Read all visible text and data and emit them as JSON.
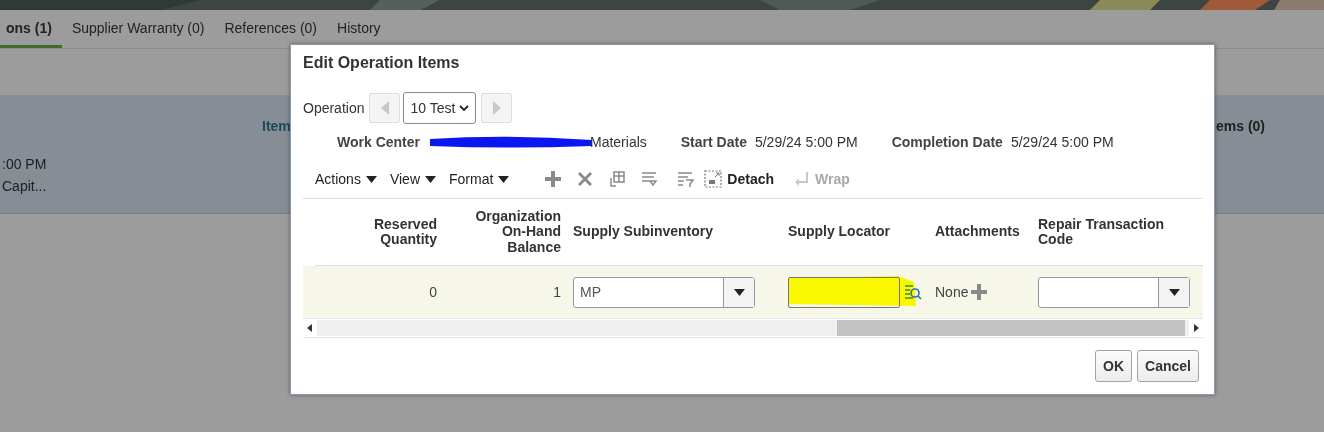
{
  "background": {
    "tabs": [
      {
        "label": "ons (1)",
        "selected": true
      },
      {
        "label": "Supplier Warranty (0)",
        "selected": false
      },
      {
        "label": "References (0)",
        "selected": false
      },
      {
        "label": "History",
        "selected": false
      }
    ],
    "panel": {
      "heading": "Item",
      "time": ":00 PM",
      "location": "Capit...",
      "right_heading": "ems (0)"
    }
  },
  "dialog": {
    "title": "Edit Operation Items",
    "operation": {
      "label": "Operation",
      "value": "10 Test",
      "prev_disabled": true,
      "next_disabled": true
    },
    "info": [
      {
        "label": "Work Center",
        "value": "Materials",
        "redacted": true
      },
      {
        "label": "Start Date",
        "value": "5/29/24 5:00 PM",
        "redacted": false
      },
      {
        "label": "Completion Date",
        "value": "5/29/24 5:00 PM",
        "redacted": false
      }
    ],
    "menus": [
      "Actions",
      "View",
      "Format"
    ],
    "tools": [
      {
        "kind": "add",
        "disabled": false
      },
      {
        "kind": "delete",
        "disabled": false
      },
      {
        "kind": "freeze",
        "disabled": false
      },
      {
        "kind": "wrap-rows",
        "disabled": false
      },
      {
        "kind": "query",
        "disabled": false
      }
    ],
    "detach": {
      "label": "Detach",
      "disabled": false
    },
    "wrap": {
      "label": "Wrap",
      "disabled": true
    },
    "table": {
      "columns": [
        "Reserved Quantity",
        "Organization On-Hand Balance",
        "Supply Subinventory",
        "Supply Locator",
        "Attachments",
        "Repair Transaction Code"
      ],
      "rows": [
        {
          "selected": true,
          "cells": [
            {
              "kind": "number",
              "text": "0"
            },
            {
              "kind": "number",
              "text": "1"
            },
            {
              "kind": "select",
              "value": "MP"
            },
            {
              "kind": "locator",
              "highlighted": true
            },
            {
              "kind": "attachments",
              "text": "None"
            },
            {
              "kind": "select"
            }
          ]
        }
      ]
    },
    "buttons": [
      "OK",
      "Cancel"
    ]
  }
}
